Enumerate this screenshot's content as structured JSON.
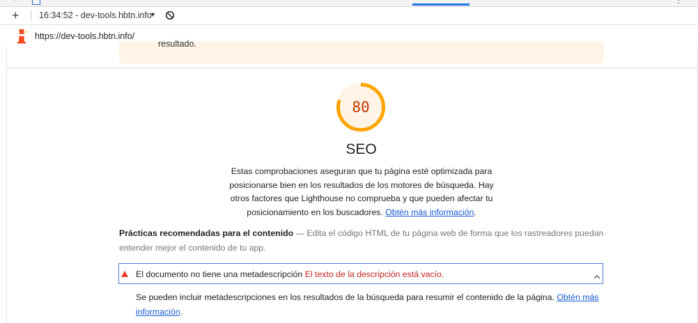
{
  "browser": {
    "session_label": "16:34:52 - dev-tools.hbtn.info",
    "url": "https://dev-tools.hbtn.info/"
  },
  "report": {
    "previous_box_fragment": "resultado.",
    "category": {
      "score": 80,
      "score_text": "80",
      "score_color": "#c33300",
      "gauge_color": "#ffa400",
      "gauge_track_color": "#fff4e5",
      "title": "SEO",
      "description": "Estas comprobaciones aseguran que tu página esté optimizada para posicionarse bien en los resultados de los motores de búsqueda. Hay otros factores que Lighthouse no comprueba y que pueden afectar tu posicionamiento en los buscadores.",
      "learn_more": "Obtén más información",
      "desc_end": "."
    },
    "group": {
      "title": "Prácticas recomendadas para el contenido",
      "dash": "—",
      "description": "Edita el código HTML de tu página web de forma que los rastreadores puedan entender mejor el contenido de tu app."
    },
    "audit": {
      "title": "El documento no tiene una metadescripción",
      "display_value": "El texto de la descripción está vacío.",
      "description": "Se pueden incluir metadescripciones en los resultados de la búsqueda para resumir el contenido de la página.",
      "learn_more": "Obtén más información",
      "desc_end": "."
    }
  }
}
